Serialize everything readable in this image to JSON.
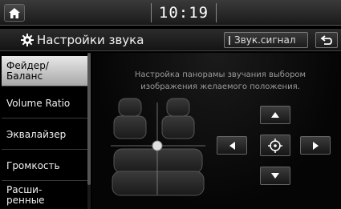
{
  "status": {
    "time": "10:19"
  },
  "title": {
    "text": "Настройки звука",
    "beep_button": "Звук.сигнал"
  },
  "sidebar": {
    "items": [
      {
        "label": "Фейдер/\nБаланс",
        "active": true
      },
      {
        "label": "Volume Ratio",
        "active": false
      },
      {
        "label": "Эквалайзер",
        "active": false
      },
      {
        "label": "Громкость",
        "active": false
      },
      {
        "label": "Расши-\nренные",
        "active": false
      }
    ]
  },
  "main": {
    "description": "Настройка панорамы звучания выбором изображения желаемого положения."
  },
  "icons": {
    "home": "home-icon",
    "settings": "gear-icon",
    "back": "back-icon",
    "up": "arrow-up-icon",
    "down": "arrow-down-icon",
    "left": "arrow-left-icon",
    "right": "arrow-right-icon",
    "center": "crosshair-center-icon"
  }
}
